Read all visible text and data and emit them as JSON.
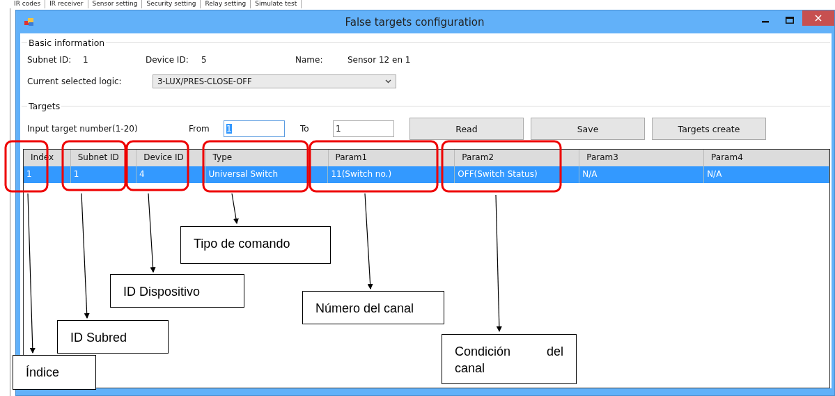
{
  "background_tabs": [
    "IR codes",
    "IR receiver",
    "Sensor setting",
    "Security setting",
    "Relay setting",
    "Simulate test"
  ],
  "window": {
    "title": "False targets configuration"
  },
  "basic_information": {
    "legend": "Basic information",
    "subnet_id_label": "Subnet ID:",
    "subnet_id": "1",
    "device_id_label": "Device ID:",
    "device_id": "5",
    "name_label": "Name:",
    "name": "Sensor 12 en 1",
    "logic_label": "Current selected logic:",
    "logic": "3-LUX/PRES-CLOSE-OFF"
  },
  "targets": {
    "legend": "Targets",
    "input_label": "Input target number(1-20)",
    "from_label": "From",
    "from": "1",
    "to_label": "To",
    "to": "1",
    "buttons": [
      "Read",
      "Save",
      "Targets create"
    ]
  },
  "table": {
    "columns": [
      "Index",
      "Subnet ID",
      "Device ID",
      "Type",
      "Param1",
      "Param2",
      "Param3",
      "Param4"
    ],
    "rows": [
      {
        "selected": true,
        "cells": [
          "1",
          "1",
          "4",
          "Universal Switch",
          "11(Switch no.)",
          "OFF(Switch Status)",
          "N/A",
          "N/A"
        ]
      }
    ]
  },
  "callouts": [
    {
      "label": "Índice"
    },
    {
      "label": "ID Subred"
    },
    {
      "label": "ID Dispositivo"
    },
    {
      "label": "Tipo de comando"
    },
    {
      "label": "Número del canal"
    },
    {
      "label": "Condición del canal"
    }
  ]
}
